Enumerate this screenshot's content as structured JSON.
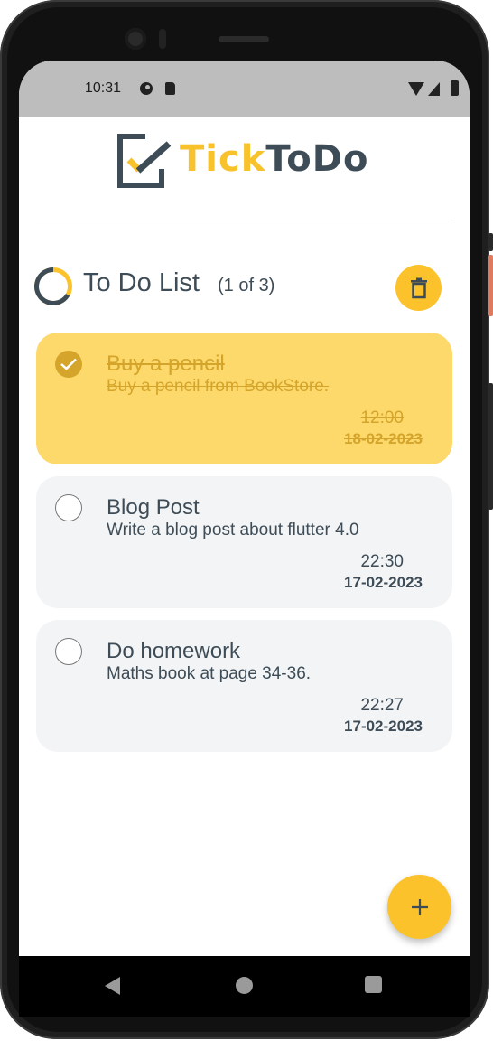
{
  "status_bar": {
    "time": "10:31"
  },
  "app": {
    "logo_tick": "Tick",
    "logo_todo": "ToDo"
  },
  "list": {
    "title": "To Do List",
    "count": "(1 of 3)",
    "progress_fraction": 0.333
  },
  "todos": [
    {
      "title": "Buy a pencil",
      "description": "Buy a pencil from BookStore.",
      "time": "12:00",
      "date": "18-02-2023",
      "done": true
    },
    {
      "title": "Blog Post",
      "description": "Write a blog post about flutter 4.0",
      "time": "22:30",
      "date": "17-02-2023",
      "done": false
    },
    {
      "title": "Do homework",
      "description": "Maths book at page 34-36.",
      "time": "22:27",
      "date": "17-02-2023",
      "done": false
    }
  ],
  "colors": {
    "accent": "#fbc22b",
    "text": "#3d4c56",
    "done_card": "#fdd86b",
    "card": "#f3f4f6"
  },
  "icons": {
    "delete": "trash-icon",
    "add": "plus-icon",
    "check": "checkmark-icon"
  }
}
